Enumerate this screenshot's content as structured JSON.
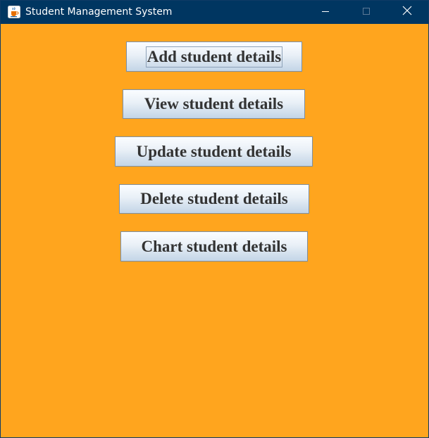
{
  "window": {
    "title": "Student Management System",
    "icon": "java-coffee-cup-icon",
    "controls": {
      "minimize_icon": "minimize-icon",
      "maximize_icon": "maximize-icon",
      "close_icon": "close-icon"
    }
  },
  "colors": {
    "titlebar": "#003661",
    "content_background": "#FFA51E",
    "button_text": "#333333"
  },
  "menu": {
    "buttons": [
      {
        "label": "Add student details",
        "focused": true
      },
      {
        "label": "View student details",
        "focused": false
      },
      {
        "label": "Update student details",
        "focused": false
      },
      {
        "label": "Delete student details",
        "focused": false
      },
      {
        "label": "Chart student details",
        "focused": false
      }
    ]
  }
}
